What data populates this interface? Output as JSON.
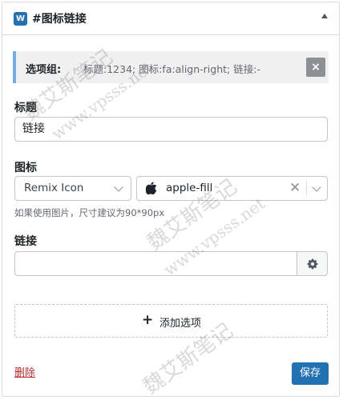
{
  "panel": {
    "icon": "logo-icon",
    "title": "#图标链接"
  },
  "summary": {
    "label": "选项组:",
    "text": "标题:1234; 图标:fa:align-right; 链接:-",
    "close_symbol": "×"
  },
  "fields": {
    "title_label": "标题",
    "title_value": "链接",
    "icon_label": "图标",
    "icon_library": "Remix Icon",
    "icon_value": "apple-fill",
    "icon_hint": "如果使用图片，尺寸建议为90*90px",
    "link_label": "链接",
    "link_value": ""
  },
  "actions": {
    "add_option_symbol": "+",
    "add_option": "添加选项",
    "delete": "删除",
    "save": "保存"
  },
  "watermark": {
    "lines": [
      "魏艾斯笔记",
      "www.vpsss.net"
    ]
  },
  "colors": {
    "accent": "#2271b1",
    "summary_border": "#72aee6",
    "delete": "#b32d2e"
  }
}
